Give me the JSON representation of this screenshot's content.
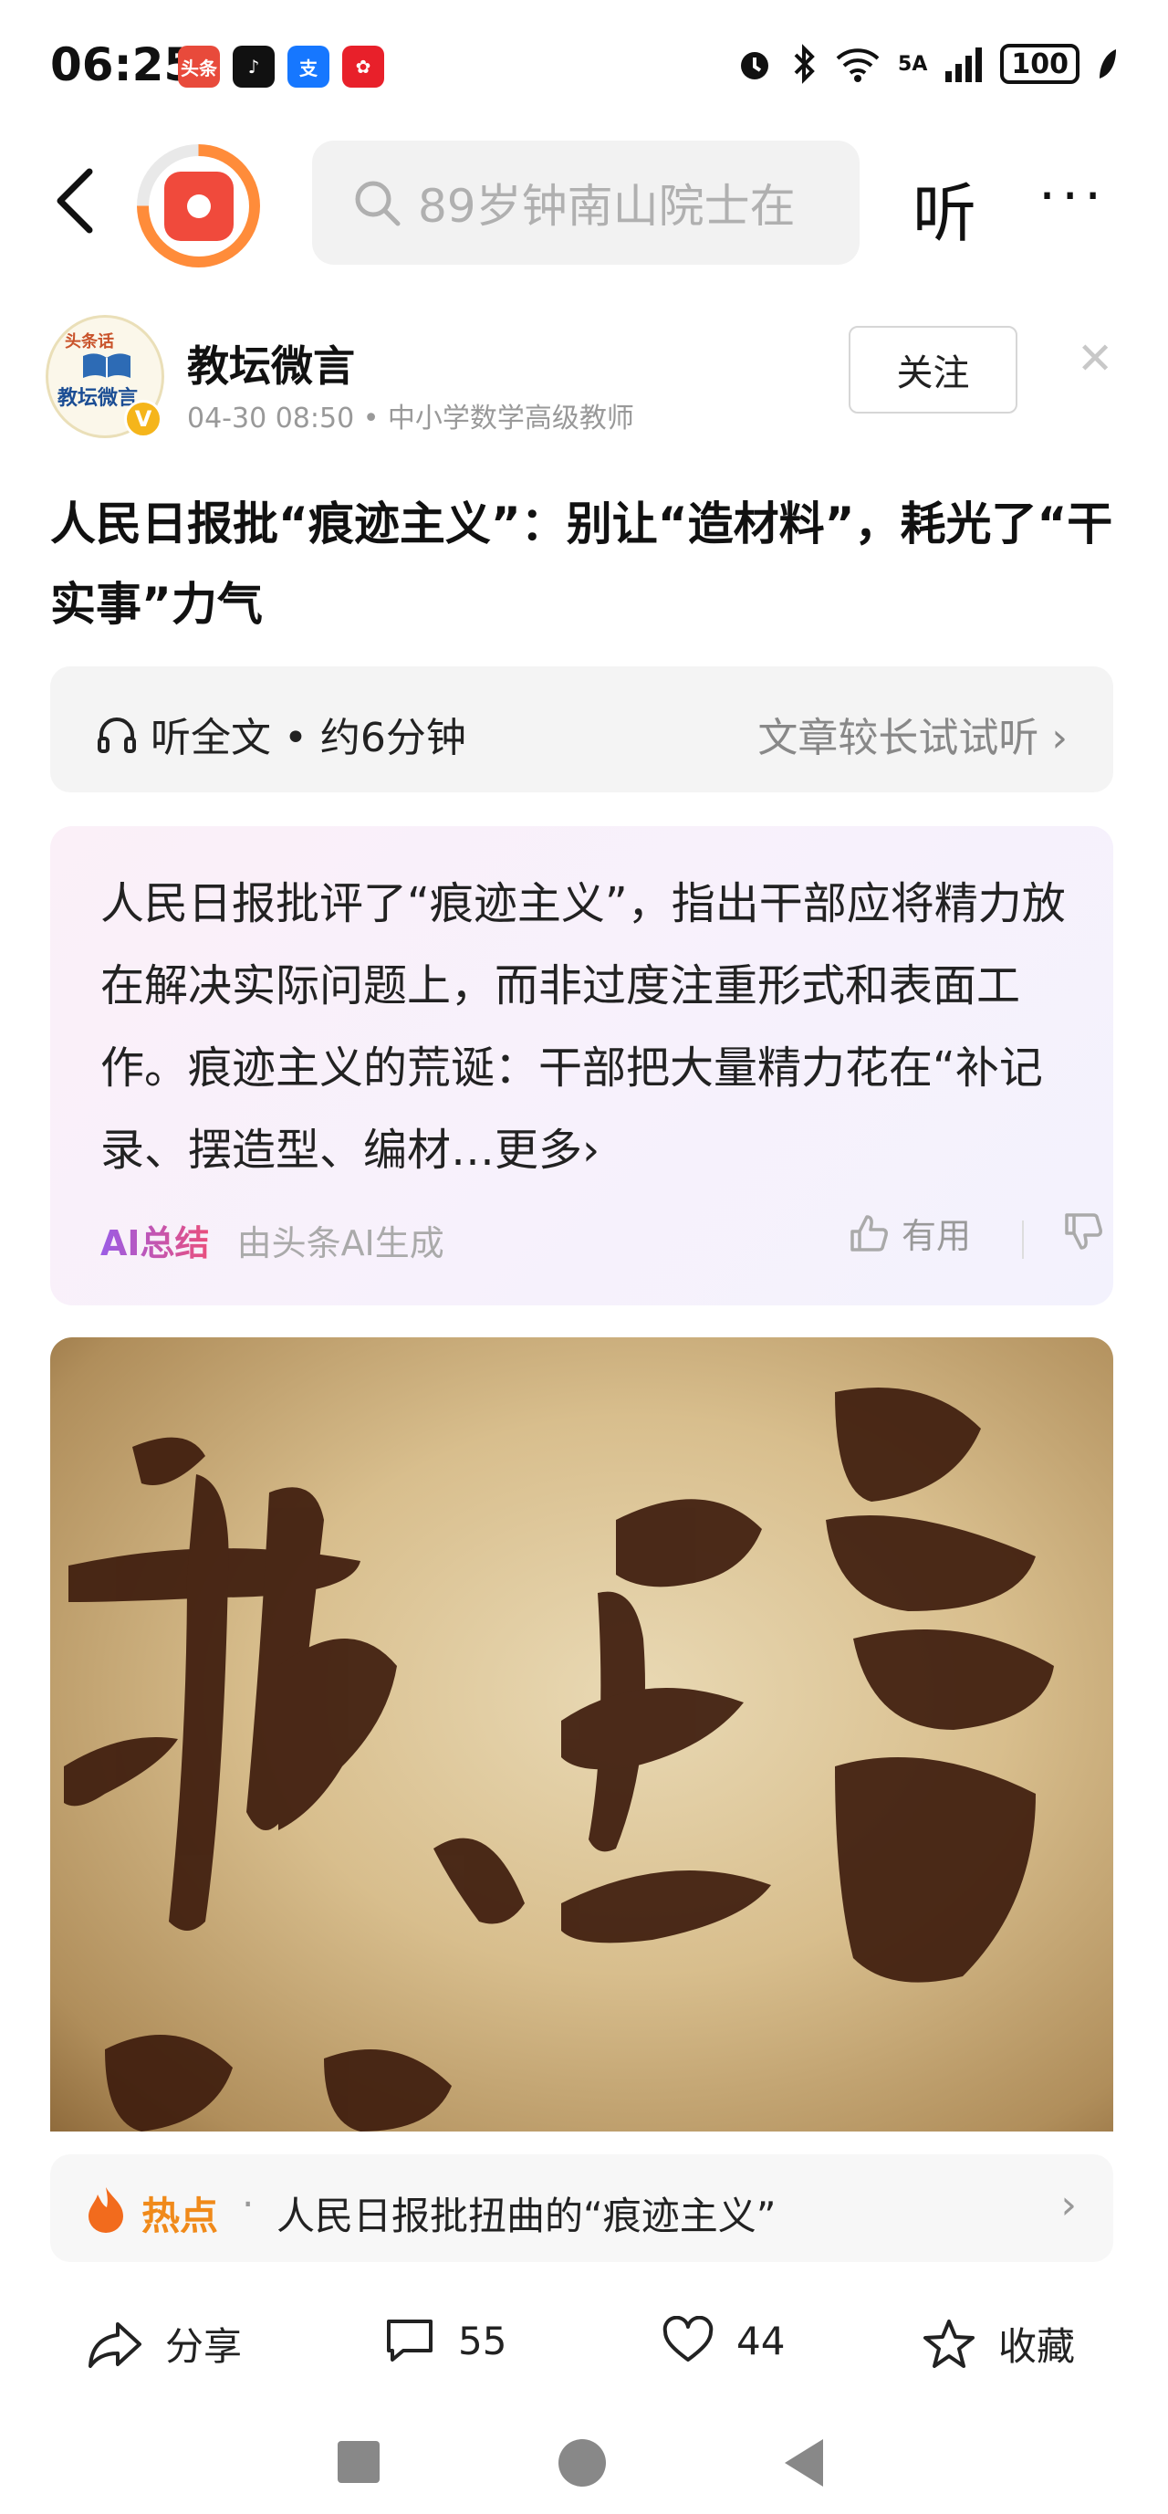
{
  "status_bar": {
    "time": "06:25",
    "apps": [
      {
        "label": "头条",
        "color": "#e84a3b"
      },
      {
        "label": "♪",
        "color": "#111111"
      },
      {
        "label": "支",
        "color": "#1677ff"
      },
      {
        "label": "✿",
        "color": "#e8202a"
      }
    ],
    "signal": "5A",
    "battery": "100"
  },
  "top_nav": {
    "search_placeholder": "89岁钟南山院士在",
    "listen_label": "听",
    "more_label": "···"
  },
  "author": {
    "name": "教坛微言",
    "meta": "04-30 08:50 • 中小学数学高级教师",
    "follow_label": "关注",
    "close_label": "✕",
    "avatar_top": "头条话",
    "avatar_text": "教坛微言",
    "verify_mark": "V"
  },
  "article": {
    "title": "人民日报批“痕迹主义”：别让“造材料”，耗光了“干实事”力气"
  },
  "listen_bar": {
    "left": "听全文 • 约6分钟",
    "right": "文章较长试试听 ›"
  },
  "ai_summary": {
    "text": "人民日报批评了“痕迹主义”，指出干部应将精力放在解决实际问题上，而非过度注重形式和表面工作。痕迹主义的荒诞：干部把大量精力花在“补记录、摆造型、编材…",
    "more_label": "更多›",
    "badge": "AI总结",
    "by": "由头条AI生成",
    "useful_label": "有用"
  },
  "hot_topic": {
    "label": "热点",
    "dot": "·",
    "text": "人民日报批扭曲的“痕迹主义”",
    "arrow": "›"
  },
  "actions": {
    "share_label": "分享",
    "comment_count": "55",
    "like_count": "44",
    "favorite_label": "收藏"
  }
}
